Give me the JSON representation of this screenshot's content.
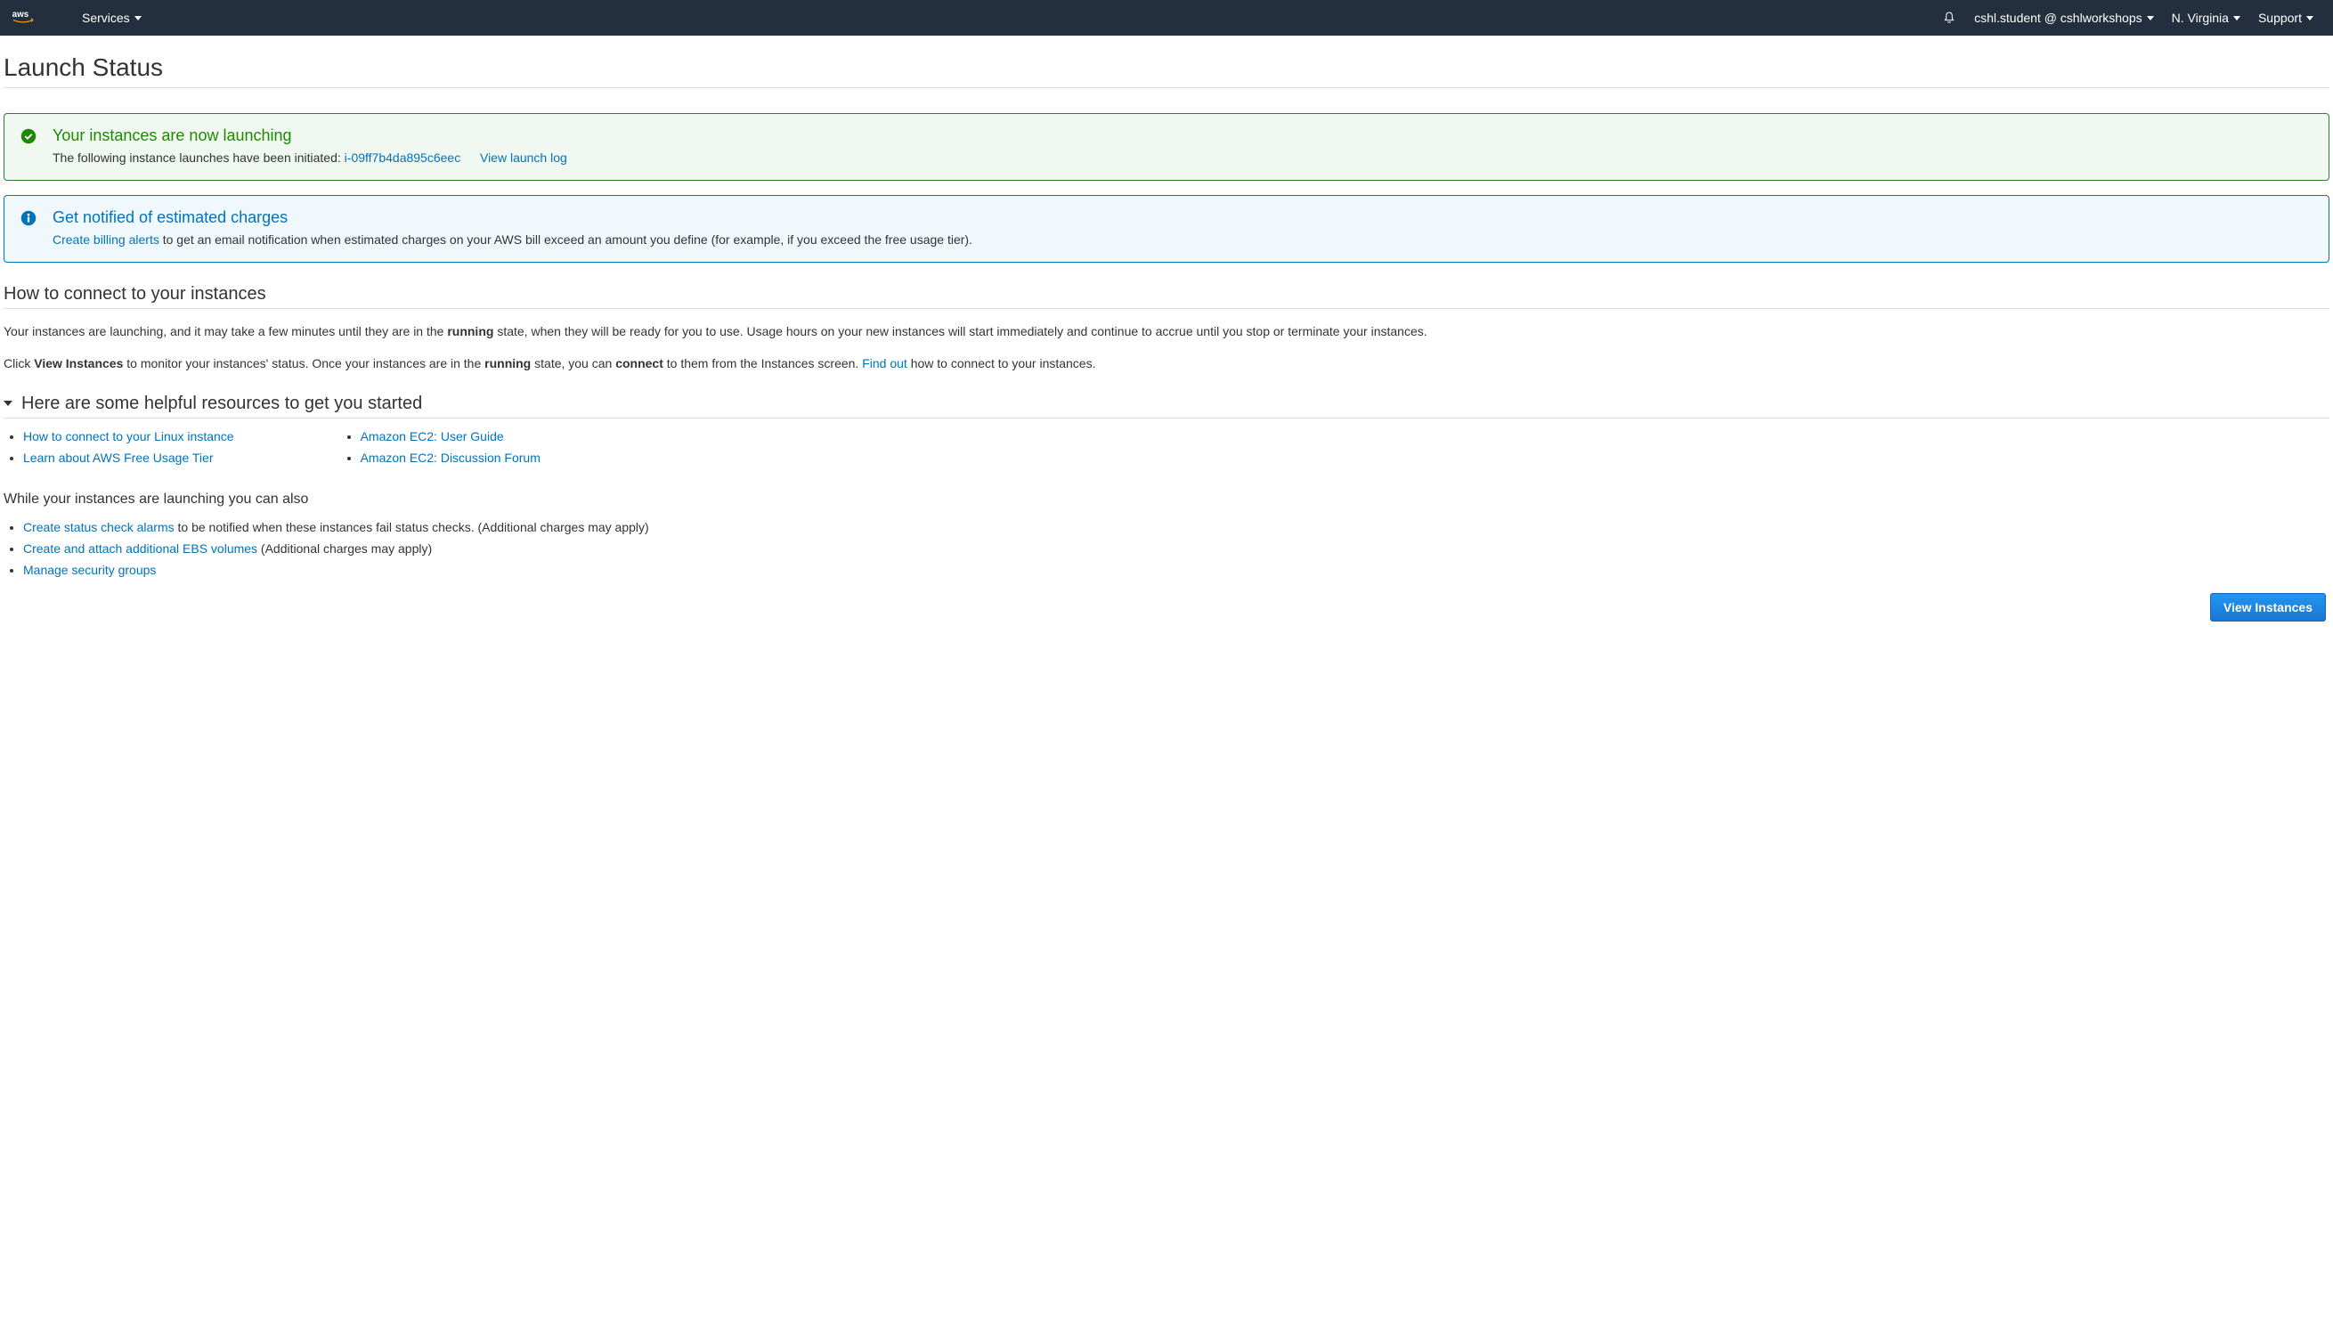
{
  "nav": {
    "services": "Services",
    "account": "cshl.student @ cshlworkshops",
    "region": "N. Virginia",
    "support": "Support"
  },
  "page": {
    "title": "Launch Status"
  },
  "success_alert": {
    "title": "Your instances are now launching",
    "text_before_id": "The following instance launches have been initiated:",
    "instance_id": "i-09ff7b4da895c6eec",
    "view_log": "View launch log"
  },
  "info_alert": {
    "title": "Get notified of estimated charges",
    "link": "Create billing alerts",
    "text_after": "to get an email notification when estimated charges on your AWS bill exceed an amount you define (for example, if you exceed the free usage tier)."
  },
  "connect_section": {
    "title": "How to connect to your instances",
    "para1_a": "Your instances are launching, and it may take a few minutes until they are in the ",
    "para1_bold1": "running",
    "para1_b": " state, when they will be ready for you to use. Usage hours on your new instances will start immediately and continue to accrue until you stop or terminate your instances.",
    "para2_a": "Click ",
    "para2_bold1": "View Instances",
    "para2_b": " to monitor your instances' status. Once your instances are in the ",
    "para2_bold2": "running",
    "para2_c": " state, you can ",
    "para2_bold3": "connect",
    "para2_d": " to them from the Instances screen. ",
    "para2_link": "Find out",
    "para2_e": " how to connect to your instances."
  },
  "resources": {
    "header": "Here are some helpful resources to get you started",
    "col1": [
      "How to connect to your Linux instance",
      "Learn about AWS Free Usage Tier"
    ],
    "col2": [
      "Amazon EC2: User Guide",
      "Amazon EC2: Discussion Forum"
    ]
  },
  "while_launching": {
    "heading": "While your instances are launching you can also",
    "items": [
      {
        "link": "Create status check alarms",
        "text": " to be notified when these instances fail status checks. (Additional charges may apply)"
      },
      {
        "link": "Create and attach additional EBS volumes",
        "text": " (Additional charges may apply)"
      },
      {
        "link": "Manage security groups",
        "text": ""
      }
    ]
  },
  "footer": {
    "view_instances": "View Instances"
  }
}
